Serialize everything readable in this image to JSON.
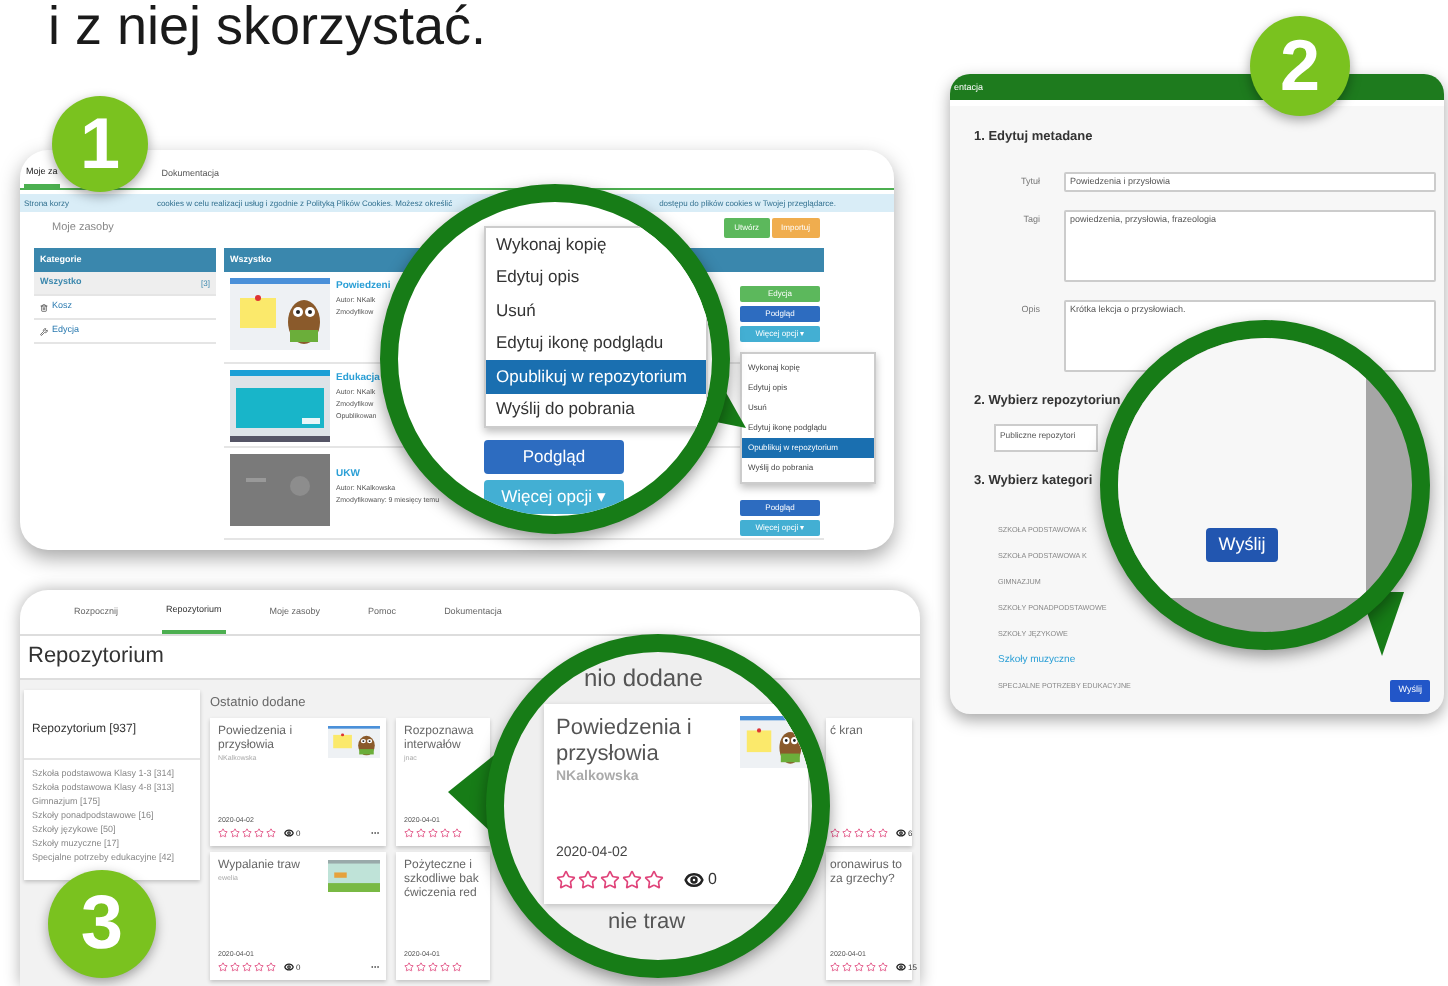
{
  "heading": "i z niej skorzystać.",
  "resources_screen": {
    "badge": "1",
    "tabs": [
      {
        "label": "Moje za",
        "selected": true
      },
      {
        "label": "Dokumentacja",
        "selected": false
      }
    ],
    "cookie_notice": [
      "Strona korzy",
      "cookies w celu realizacji usług i zgodnie z Polityką Plików Cookies. Możesz określić",
      "dostępu do plików cookies w Twojej przeglądarce."
    ],
    "title": "Moje zasoby",
    "actions": [
      {
        "label": "Utwórz",
        "kind": "success"
      },
      {
        "label": "Importuj",
        "kind": "warning"
      }
    ],
    "sidebar": {
      "title": "Kategorie",
      "items": [
        {
          "label": "Wszystko",
          "count": "[3]",
          "kind": "all",
          "selected": true
        },
        {
          "label": "Kosz",
          "kind": "trash",
          "selected": false
        },
        {
          "label": "Edycja",
          "kind": "edit",
          "selected": false
        }
      ]
    },
    "list": {
      "title": "Wszystko",
      "items": [
        {
          "kind": "owl",
          "title": "Powiedzeni",
          "lines": [
            "Autor: NKalk",
            "Zmodyfikow"
          ],
          "buttons": [
            {
              "label": "Edycja",
              "kind": "success"
            },
            {
              "label": "Podgląd",
              "kind": "primary"
            },
            {
              "label": "Więcej opcji ▾",
              "kind": "info"
            }
          ]
        },
        {
          "kind": "slide",
          "title": "Edukacja",
          "lines": [
            "Autor: NKalk",
            "Zmodyfikow",
            "Opublikowan"
          ]
        },
        {
          "kind": "video",
          "title": "UKW",
          "lines": [
            "Autor: NKalkowska",
            "Zmodyfikowany: 9 miesięcy temu"
          ],
          "buttons": [
            {
              "label": "Podgląd",
              "kind": "primary"
            },
            {
              "label": "Więcej opcji ▾",
              "kind": "info"
            }
          ]
        }
      ]
    },
    "dropdown": [
      {
        "label": "Wykonaj kopię",
        "selected": false
      },
      {
        "label": "Edytuj opis",
        "selected": false
      },
      {
        "label": "Usuń",
        "selected": false
      },
      {
        "label": "Edytuj ikonę podglądu",
        "selected": false
      },
      {
        "label": "Opublikuj w repozytorium",
        "selected": true
      },
      {
        "label": "Wyślij do pobrania",
        "selected": false
      }
    ],
    "magnifier": {
      "menu": [
        {
          "label": "Wykonaj kopię",
          "selected": false
        },
        {
          "label": "Edytuj opis",
          "selected": false
        },
        {
          "label": "Usuń",
          "selected": false
        },
        {
          "label": "Edytuj ikonę podglądu",
          "selected": false
        },
        {
          "label": "Opublikuj w repozytorium",
          "selected": true
        },
        {
          "label": "Wyślij do pobrania",
          "selected": false
        }
      ],
      "buttons": [
        {
          "label": "Podgląd",
          "kind": "primary"
        },
        {
          "label": "Więcej opcji ▾",
          "kind": "info"
        }
      ]
    }
  },
  "publish_dialog": {
    "badge": "2",
    "header": "entacja",
    "section_1": "1. Edytuj metadane",
    "fields": [
      {
        "label": "Tytuł",
        "value": "Powiedzenia i przysłowia",
        "kind": "input"
      },
      {
        "label": "Tagi",
        "value": "powiedzenia, przysłowia, frazeologia",
        "kind": "textarea"
      },
      {
        "label": "Opis",
        "value": "Krótka lekcja o przysłowiach.",
        "kind": "textarea"
      }
    ],
    "section_2": "2. Wybierz repozytoriun",
    "repository": "Publiczne repozytori",
    "section_3": "3. Wybierz kategori",
    "categories": [
      {
        "label": "SZKOŁA PODSTAWOWA K",
        "selected": false
      },
      {
        "label": "SZKOŁA PODSTAWOWA K",
        "selected": false
      },
      {
        "label": "GIMNAZJUM",
        "selected": false
      },
      {
        "label": "SZKOŁY PONADPODSTAWOWE",
        "selected": false
      },
      {
        "label": "SZKOŁY JĘZYKOWE",
        "selected": false
      },
      {
        "label": "Szkoły muzyczne",
        "selected": true
      },
      {
        "label": "SPECJALNE POTRZEBY EDUKACYJNE",
        "selected": false
      }
    ],
    "submit": "Wyślij",
    "magnifier": {
      "button": "Wyślij"
    }
  },
  "repository_screen": {
    "badge": "3",
    "tabs": [
      {
        "label": "Rozpocznij",
        "selected": false
      },
      {
        "label": "Repozytorium",
        "selected": true
      },
      {
        "label": "Moje zasoby",
        "selected": false
      },
      {
        "label": "Pomoc",
        "selected": false
      },
      {
        "label": "Dokumentacja",
        "selected": false
      }
    ],
    "title": "Repozytorium",
    "sidebar": {
      "title": "Repozytorium [937]",
      "items": [
        "Szkoła podstawowa Klasy 1-3 [314]",
        "Szkoła podstawowa Klasy 4-8 [313]",
        "Gimnazjum [175]",
        "Szkoły ponadpodstawowe [16]",
        "Szkoły językowe [50]",
        "Szkoły muzyczne [17]",
        "Specjalne potrzeby edukacyjne [42]"
      ]
    },
    "section_title": "Ostatnio dodane",
    "columns": [
      [
        {
          "kind": "owl",
          "title_lines": [
            "Powiedzenia i",
            "przysłowia"
          ],
          "author": "NKalkowska",
          "date": "2020-04-02",
          "stars": 0,
          "views": "0"
        },
        {
          "kind": "landscape",
          "title_lines": [
            "Wypalanie traw"
          ],
          "author": "ewelia",
          "date": "2020-04-01",
          "stars": 0,
          "views": "0"
        }
      ],
      [
        {
          "title_lines": [
            "Rozpoznawa",
            "interwałów"
          ],
          "author": "jnac",
          "date": "2020-04-01",
          "stars": 0
        },
        {
          "title_lines": [
            "Pożyteczne i",
            "szkodliwe bak",
            "ćwiczenia red"
          ],
          "date": "2020-04-01",
          "stars": 0
        }
      ],
      [
        {
          "title_lines": [
            "ć kran"
          ],
          "stars": 0,
          "views": "6"
        },
        {
          "title_lines": [
            "oronawirus to",
            "za grzechy?"
          ],
          "date": "2020-04-01",
          "stars": 0,
          "views": "15"
        }
      ]
    ],
    "magnifier": {
      "section_title": "nio dodane",
      "card": {
        "kind": "owl",
        "title_lines": [
          "Powiedzenia i",
          "przysłowia"
        ],
        "author": "NKalkowska",
        "date": "2020-04-02",
        "stars": 0,
        "views": "0"
      },
      "next_title": "nie traw"
    }
  }
}
